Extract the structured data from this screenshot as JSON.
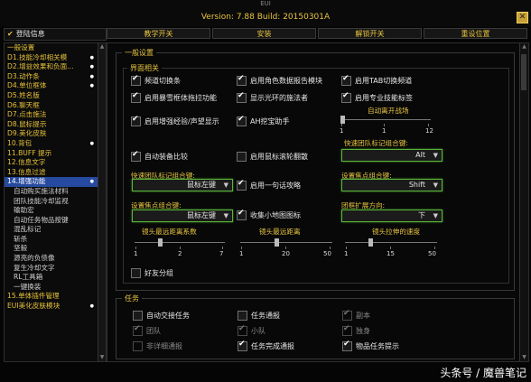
{
  "window": {
    "app_title": "EUI",
    "version": "Version: 7.88 Build: 20150301A"
  },
  "left_header": "登陆信息",
  "tabs": [
    "教学开关",
    "安装",
    "解锁开关",
    "重设位置"
  ],
  "sidebar": {
    "items": [
      {
        "label": "一般设置",
        "sub": false,
        "dot": false
      },
      {
        "label": "D1.技能冷却相关模",
        "sub": false,
        "dot": true
      },
      {
        "label": "D2.增益效果和负面...",
        "sub": false,
        "dot": true
      },
      {
        "label": "D3.动作条",
        "sub": false,
        "dot": true
      },
      {
        "label": "D4.单位框体",
        "sub": false,
        "dot": true
      },
      {
        "label": "D5.姓名版",
        "sub": false,
        "dot": false
      },
      {
        "label": "D6.聊天框",
        "sub": false,
        "dot": false
      },
      {
        "label": "D7.点击施法",
        "sub": false,
        "dot": false
      },
      {
        "label": "D8.鼠标提示",
        "sub": false,
        "dot": false
      },
      {
        "label": "D9.美化皮肤",
        "sub": false,
        "dot": false
      },
      {
        "label": "10.背包",
        "sub": false,
        "dot": true
      },
      {
        "label": "11.BUFF 提示",
        "sub": false,
        "dot": false
      },
      {
        "label": "12.信息文字",
        "sub": false,
        "dot": false
      },
      {
        "label": "13.信息过滤",
        "sub": false,
        "dot": false
      },
      {
        "label": "14.增强功能",
        "sub": false,
        "dot": true,
        "active": true
      },
      {
        "label": "自动购买施法材料",
        "sub": true,
        "dot": false
      },
      {
        "label": "团队技能冷却监视",
        "sub": true,
        "dot": false
      },
      {
        "label": "输助宏",
        "sub": true,
        "dot": false
      },
      {
        "label": "自动任务物品按键",
        "sub": true,
        "dot": false
      },
      {
        "label": "混乱标记",
        "sub": true,
        "dot": false
      },
      {
        "label": "斩杀",
        "sub": true,
        "dot": false
      },
      {
        "label": "坚毅",
        "sub": true,
        "dot": false
      },
      {
        "label": "源亮的负债像",
        "sub": true,
        "dot": false
      },
      {
        "label": "复生冷却文字",
        "sub": true,
        "dot": false
      },
      {
        "label": "RL工具箱",
        "sub": true,
        "dot": false
      },
      {
        "label": "一键换装",
        "sub": true,
        "dot": false
      },
      {
        "label": "15.单体插件管理",
        "sub": false,
        "dot": false
      },
      {
        "label": "EUI美化皮肤模块",
        "sub": false,
        "dot": true
      }
    ]
  },
  "general": {
    "legend": "一般设置",
    "ui_legend": "界面相关",
    "checkboxes": [
      {
        "label": "频道切换条",
        "on": true
      },
      {
        "label": "启用角色数据报告模块",
        "on": true
      },
      {
        "label": "启用TAB切换频道",
        "on": true
      },
      {
        "label": "启用暴雪框体拖拉功能",
        "on": true
      },
      {
        "label": "显示光环的施法者",
        "on": true
      },
      {
        "label": "启用专业技能标签",
        "on": true
      },
      {
        "label": "启用增强经验/声望显示",
        "on": true
      },
      {
        "label": "AH挖宝助手",
        "on": true
      },
      {
        "label": "自动装备比较",
        "on": true
      },
      {
        "label": "启用鼠标滚轮翻散",
        "on": false
      },
      {
        "label": "启用一句话攻略",
        "on": true
      },
      {
        "label": "收集小地图图标",
        "on": true
      },
      {
        "label": "好友分组",
        "on": false
      }
    ],
    "auto_leave": {
      "label": "自动离开战场",
      "value": 1,
      "min": 1,
      "max": 12,
      "mid": 1
    },
    "combos": [
      {
        "label": "快速团队标记组合键:",
        "value": "Alt"
      },
      {
        "label": "快速团队标记组合键:",
        "value": "鼠标左键"
      },
      {
        "label": "设置焦点组合键:",
        "value": "Shift"
      },
      {
        "label": "设置焦点组合键:",
        "value": "鼠标左键"
      },
      {
        "label": "团框扩展方向:",
        "value": "下"
      }
    ],
    "sliders": [
      {
        "label": "镜头最远距离系数",
        "min": 1,
        "mid": 2,
        "max": 7,
        "value": 2
      },
      {
        "label": "镜头最远距离",
        "min": 1,
        "mid": 20,
        "max": 50,
        "value": 20
      },
      {
        "label": "镜头拉伸的速度",
        "min": 1,
        "mid": 15,
        "max": 50,
        "value": 15
      }
    ]
  },
  "tasks": {
    "legend": "任务",
    "checkboxes": [
      {
        "label": "自动交接任务",
        "on": false,
        "dim": false
      },
      {
        "label": "任务通报",
        "on": false,
        "dim": false
      },
      {
        "label": "副本",
        "on": true,
        "dim": true
      },
      {
        "label": "团队",
        "on": true,
        "dim": true
      },
      {
        "label": "小队",
        "on": true,
        "dim": true
      },
      {
        "label": "独身",
        "on": true,
        "dim": true
      },
      {
        "label": "非详细通报",
        "on": false,
        "dim": true
      },
      {
        "label": "任务完成通报",
        "on": true,
        "dim": false
      },
      {
        "label": "物品任务提示",
        "on": true,
        "dim": false
      }
    ]
  },
  "watermark": "头条号 / 魔兽笔记"
}
